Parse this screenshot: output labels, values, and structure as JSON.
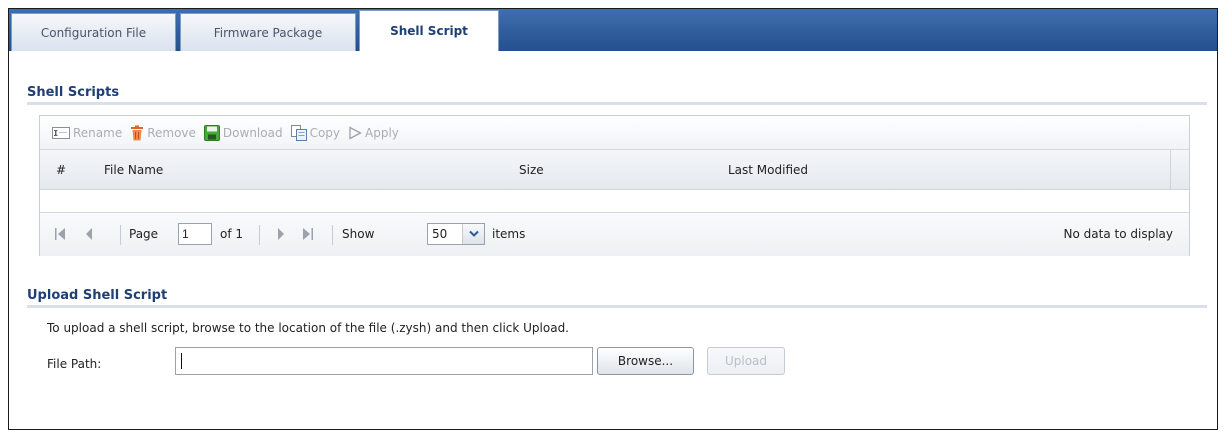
{
  "tabs": [
    {
      "label": "Configuration File",
      "active": false
    },
    {
      "label": "Firmware Package",
      "active": false
    },
    {
      "label": "Shell Script",
      "active": true
    }
  ],
  "shell_scripts": {
    "title": "Shell Scripts",
    "toolbar": {
      "rename": "Rename",
      "remove": "Remove",
      "download": "Download",
      "copy": "Copy",
      "apply": "Apply"
    },
    "columns": [
      "#",
      "File Name",
      "Size",
      "Last Modified"
    ],
    "rows": [],
    "pager": {
      "page_label": "Page",
      "page_value": "1",
      "of_label": "of 1",
      "show_label": "Show",
      "items_per_page": "50",
      "items_label": "items",
      "status": "No data to display"
    }
  },
  "upload": {
    "title": "Upload Shell Script",
    "description": "To upload a shell script, browse to the location of the file (.zysh) and then click Upload.",
    "file_path_label": "File Path:",
    "file_path_value": "",
    "browse_label": "Browse...",
    "upload_label": "Upload"
  },
  "colors": {
    "tabbar": "#2f5d9c",
    "section_title": "#1f3f75",
    "disabled_text": "#a9aeb5"
  }
}
